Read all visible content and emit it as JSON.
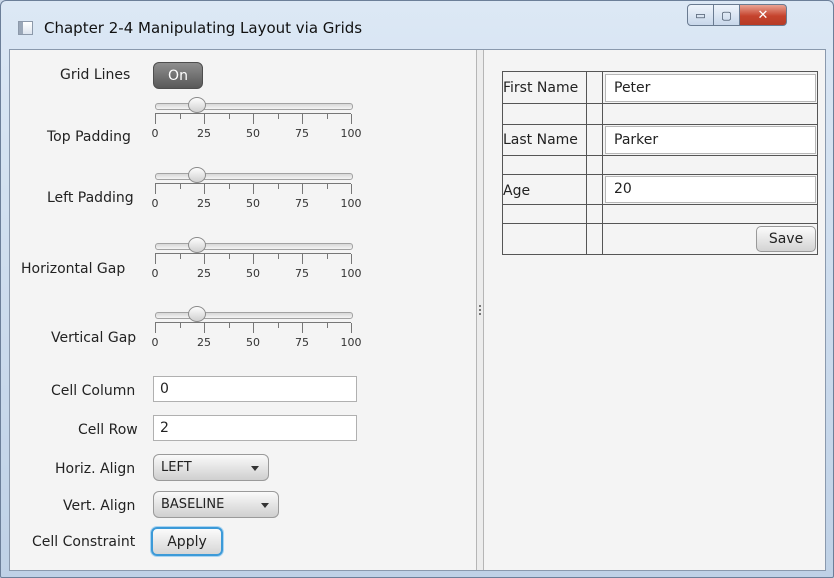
{
  "window": {
    "title": "Chapter 2-4 Manipulating Layout via Grids",
    "controls": {
      "minimize": "▭",
      "maximize": "▢",
      "close": "✕"
    }
  },
  "controls": {
    "grid_lines": {
      "label": "Grid Lines",
      "toggle": "On"
    },
    "sliders": [
      {
        "label": "Top Padding",
        "value": 10,
        "min": 0,
        "max": 100,
        "tick_labels": [
          "0",
          "25",
          "50",
          "75",
          "100"
        ]
      },
      {
        "label": "Left Padding",
        "value": 10,
        "min": 0,
        "max": 100,
        "tick_labels": [
          "0",
          "25",
          "50",
          "75",
          "100"
        ]
      },
      {
        "label": "Horizontal Gap",
        "value": 10,
        "min": 0,
        "max": 100,
        "tick_labels": [
          "0",
          "25",
          "50",
          "75",
          "100"
        ]
      },
      {
        "label": "Vertical Gap",
        "value": 10,
        "min": 0,
        "max": 100,
        "tick_labels": [
          "0",
          "25",
          "50",
          "75",
          "100"
        ]
      }
    ],
    "cell_column": {
      "label": "Cell Column",
      "value": "0"
    },
    "cell_row": {
      "label": "Cell Row",
      "value": "2"
    },
    "horiz_align": {
      "label": "Horiz. Align",
      "value": "LEFT"
    },
    "vert_align": {
      "label": "Vert. Align",
      "value": "BASELINE"
    },
    "cell_constraint": {
      "label": "Cell Constraint",
      "button": "Apply"
    }
  },
  "form": {
    "first_name": {
      "label": "First Name",
      "value": "Peter"
    },
    "last_name": {
      "label": "Last Name",
      "value": "Parker"
    },
    "age": {
      "label": "Age",
      "value": "20"
    },
    "save_label": "Save"
  }
}
